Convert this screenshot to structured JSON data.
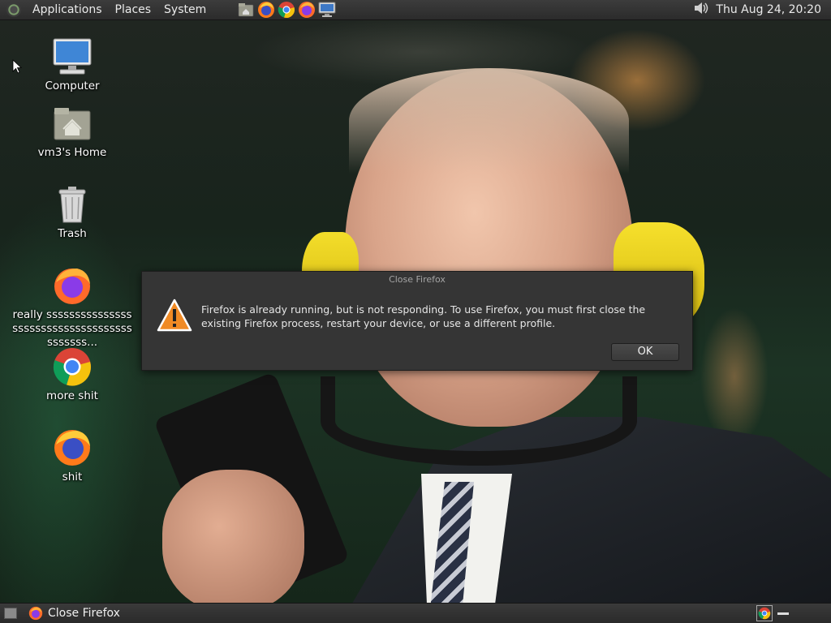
{
  "top_panel": {
    "menus": [
      "Applications",
      "Places",
      "System"
    ],
    "launchers": [
      "home-folder-icon",
      "firefox-icon",
      "chrome-icon",
      "firefox-icon",
      "monitor-icon"
    ],
    "clock": "Thu Aug 24, 20:20",
    "volume_icon": "speaker-icon"
  },
  "desktop_icons": [
    {
      "label": "Computer",
      "icon": "computer-icon"
    },
    {
      "label": "vm3's Home",
      "icon": "home-folder-icon"
    },
    {
      "label": "Trash",
      "icon": "trash-icon"
    },
    {
      "label": "really sssssssssssssssssssssssssssssssssssssssssss...",
      "icon": "firefox-icon"
    },
    {
      "label": "more shit",
      "icon": "chrome-icon"
    },
    {
      "label": "shit",
      "icon": "firefox-icon"
    }
  ],
  "dialog": {
    "title": "Close Firefox",
    "message": "Firefox is already running, but is not responding. To use Firefox, you must first close the existing Firefox process, restart your device, or use a different profile.",
    "ok_label": "OK",
    "icon": "warning-icon"
  },
  "bottom_panel": {
    "task_label": "Close Firefox",
    "task_icon": "firefox-icon"
  },
  "colors": {
    "panel": "#2f2f2f",
    "dialog_bg": "#353535",
    "warning_orange": "#f08a24",
    "earmuff_yellow": "#f3dd2a"
  }
}
